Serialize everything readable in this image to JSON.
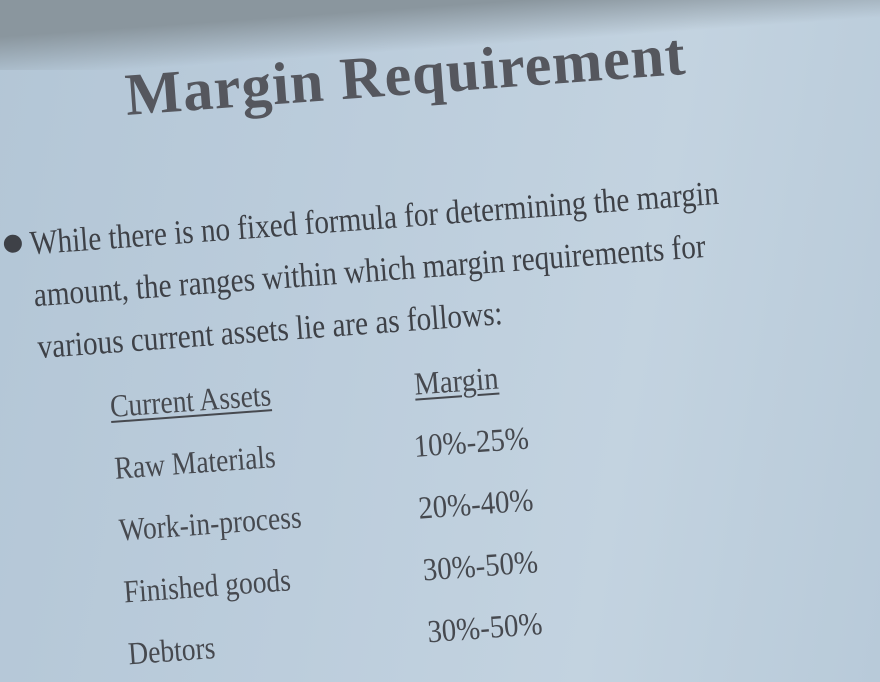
{
  "slide": {
    "title": "Margin Requirement",
    "paragraph_lines": [
      "While there is no fixed formula for determining the margin",
      "amount, the ranges within which margin requirements for",
      "various current assets lie are as follows:"
    ],
    "table": {
      "headers": {
        "asset": "Current Assets",
        "margin": "Margin"
      },
      "rows": [
        {
          "asset": "Raw Materials",
          "margin": "10%-25%"
        },
        {
          "asset": "Work-in-process",
          "margin": "20%-40%"
        },
        {
          "asset": "Finished goods",
          "margin": "30%-50%"
        },
        {
          "asset": "Debtors",
          "margin": "30%-50%"
        }
      ]
    }
  }
}
